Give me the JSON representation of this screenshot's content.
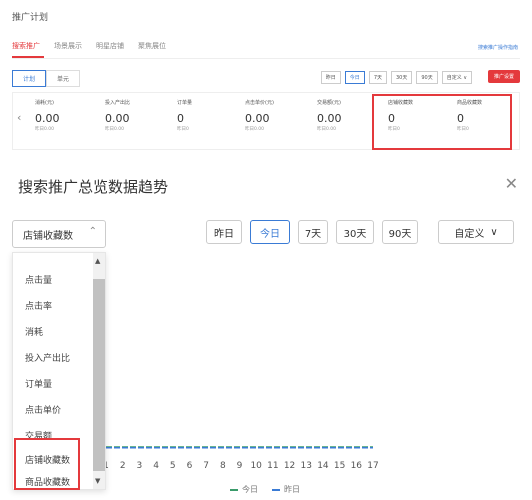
{
  "page": {
    "title": "推广计划",
    "tabs": [
      "搜索推广",
      "场景展示",
      "明星店铺",
      "聚焦展位"
    ],
    "help_link": "搜索推广操作指南",
    "sub_tabs": [
      "计划",
      "单元"
    ],
    "ranges": [
      "昨日",
      "今日",
      "7天",
      "30天",
      "90天",
      "自定义 ∨"
    ],
    "red_button": "推广设置",
    "metrics": [
      {
        "label": "消耗(元)",
        "value": "0.00",
        "sub": "昨日0.00"
      },
      {
        "label": "投入产出比",
        "value": "0.00",
        "sub": "昨日0.00"
      },
      {
        "label": "订单量",
        "value": "0",
        "sub": "昨日0"
      },
      {
        "label": "点击单价(元)",
        "value": "0.00",
        "sub": "昨日0.00"
      },
      {
        "label": "交易额(元)",
        "value": "0.00",
        "sub": "昨日0.00"
      },
      {
        "label": "店铺收藏数",
        "value": "0",
        "sub": "昨日0"
      },
      {
        "label": "商品收藏数",
        "value": "0",
        "sub": "昨日0"
      }
    ]
  },
  "modal": {
    "title": "搜索推广总览数据趋势",
    "close_icon": "close-icon",
    "select_value": "店铺收藏数",
    "ranges": [
      "昨日",
      "今日",
      "7天",
      "30天",
      "90天"
    ],
    "active_range": "今日",
    "custom_label": "自定义",
    "dropdown_items": [
      "点击量",
      "点击率",
      "消耗",
      "投入产出比",
      "订单量",
      "点击单价",
      "交易额",
      "店铺收藏数",
      "商品收藏数"
    ],
    "highlighted_items": [
      "店铺收藏数",
      "商品收藏数"
    ]
  },
  "chart_data": {
    "type": "line",
    "x": [
      "1",
      "2",
      "3",
      "4",
      "5",
      "6",
      "7",
      "8",
      "9",
      "10",
      "11",
      "12",
      "13",
      "14",
      "15",
      "16",
      "17"
    ],
    "series": [
      {
        "name": "今日",
        "values": [
          0,
          0,
          0,
          0,
          0,
          0,
          0,
          0,
          0,
          0,
          0,
          0,
          0,
          0,
          0,
          0,
          0
        ]
      },
      {
        "name": "昨日",
        "values": [
          0,
          0,
          0,
          0,
          0,
          0,
          0,
          0,
          0,
          0,
          0,
          0,
          0,
          0,
          0,
          0,
          0
        ]
      }
    ],
    "colors": {
      "today": "#3a9b6a",
      "yesterday": "#3a7bd5"
    }
  }
}
